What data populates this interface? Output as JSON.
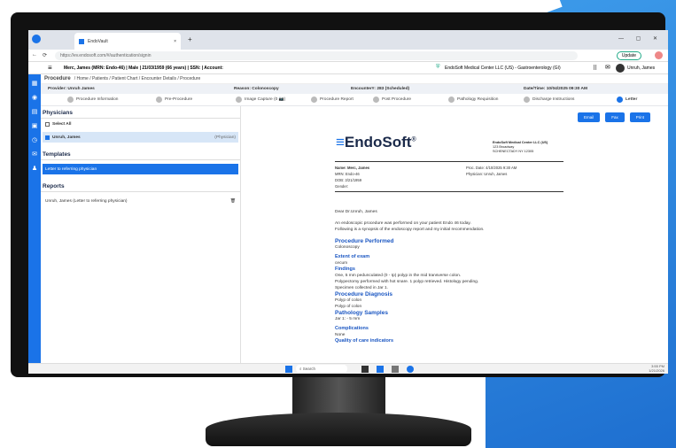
{
  "browser": {
    "tab_title": "EndoVault",
    "url": "https://ev.endosoft.com/#/authentication/signin",
    "update_label": "Update"
  },
  "patient_bar": {
    "info": "Merc, James (MRN: Endo-46) | Male | 21/03/1959 (66 years) | SSN: | Account:",
    "facility": "EndoSoft Medical Center LLC (US) - Gastroenterology (GI)",
    "user": "Unruh, James"
  },
  "breadcrumb": {
    "section": "Procedure",
    "path": "/ Home / Patients / Patient Chart / Encounter Details / Procedure"
  },
  "info": {
    "provider": "Provider: Unruh James",
    "reason": "Reason: Colonoscopy",
    "encounter": "Encounter#: 283 (Scheduled)",
    "datetime": "Date/Time: 10/04/2025 09:30 AM"
  },
  "steps": [
    {
      "label": "Procedure Information"
    },
    {
      "label": "Pre-Procedure"
    },
    {
      "label": "Image Capture (0 📷)"
    },
    {
      "label": "Procedure Report"
    },
    {
      "label": "Post Procedure"
    },
    {
      "label": "Pathology Requisition"
    },
    {
      "label": "Discharge Instructions"
    },
    {
      "label": "Letter"
    }
  ],
  "left": {
    "physicians_title": "Physicians",
    "select_all": "Select All",
    "physician_name": "Unruh, James",
    "physician_role": "(Physician)",
    "templates_title": "Templates",
    "template_item": "Letter to referring physician",
    "reports_title": "Reports",
    "report_item": "Unruh, James (Letter to referring physician)"
  },
  "doc": {
    "buttons": {
      "email": "Email",
      "fax": "Fax",
      "print": "Print"
    },
    "brand": "EndoSoft",
    "brand_mark": "®",
    "clinic": [
      "EndoSoft Medical Center LLC (US)",
      "123 Broadway",
      "SCHENECTADY NY 12305"
    ],
    "name": "Name: Merc, James",
    "mrn": "MRN: Endo-46",
    "dob": "DOB: 3/21/1959",
    "gender": "Gender:",
    "proc_date": "Proc. Date: 4/10/2025 9:30 AM",
    "physician": "Physician: Unruh, James",
    "salutation": "Dear Dr.Unruh, James",
    "intro1": "An endoscopic procedure was performed on your patient Endo 46 today.",
    "intro2": "Following is a synopsis of the endoscopy report and my initial recommendation.",
    "sections": {
      "performed_title": "Procedure Performed",
      "performed": "Colonoscopy",
      "extent_title": "Extent of exam",
      "extent": "cecum",
      "findings_title": "Findings",
      "findings1": "One, 5 mm pedunculated (0 - Ip) polyp in the mid transverse colon.",
      "findings2": "Polypectomy performed with hot snare. 1 polyp retrieved. Histology pending.",
      "findings3": "Specimen collected in Jar 1.",
      "diagnosis_title": "Procedure Diagnosis",
      "diagnosis1": "Polyp of colon",
      "diagnosis2": "Polyp of colon",
      "samples_title": "Pathology Samples",
      "samples": "Jar 1: - 5 mm",
      "complications_title": "Complications",
      "complications": "None",
      "quality_title": "Quality of care indicators"
    }
  },
  "taskbar": {
    "search": "Search",
    "time": "3:55 PM",
    "date": "1/21/2026"
  },
  "colors": {
    "brand_blue": "#1a73e8",
    "heading": "#1a56c2"
  }
}
